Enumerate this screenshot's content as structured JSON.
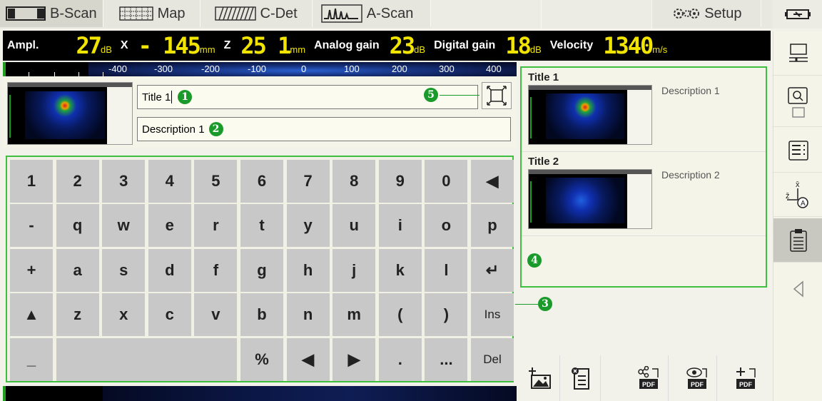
{
  "tabs": [
    {
      "label": "B-Scan",
      "icon": "bscan-icon",
      "active": true
    },
    {
      "label": "Map",
      "icon": "map-icon",
      "active": false
    },
    {
      "label": "C-Det",
      "icon": "cdet-icon",
      "active": false
    },
    {
      "label": "A-Scan",
      "icon": "ascan-icon",
      "active": false
    }
  ],
  "setup_label": "Setup",
  "readout": {
    "ampl_label": "Ampl.",
    "ampl_value": "27",
    "ampl_unit": "dB",
    "x_label": "X",
    "x_value": "- 145",
    "x_unit": "mm",
    "z_label": "Z",
    "z_value": "25 1",
    "z_unit": "mm",
    "analog_label": "Analog gain",
    "analog_value": "23",
    "analog_unit": "dB",
    "digital_label": "Digital gain",
    "digital_value": "18",
    "digital_unit": "dB",
    "velocity_label": "Velocity",
    "velocity_value": "1340",
    "velocity_unit": "m/s"
  },
  "ruler_ticks": [
    "-400",
    "-300",
    "-200",
    "-100",
    "0",
    "100",
    "200",
    "300",
    "400"
  ],
  "editor": {
    "title_value": "Title 1",
    "description_value": "Description 1"
  },
  "callouts": {
    "c1": "1",
    "c2": "2",
    "c3": "3",
    "c4": "4",
    "c5": "5"
  },
  "keyboard": {
    "row1": [
      "1",
      "2",
      "3",
      "4",
      "5",
      "6",
      "7",
      "8",
      "9",
      "0",
      "◀"
    ],
    "row2": [
      "-",
      "q",
      "w",
      "e",
      "r",
      "t",
      "y",
      "u",
      "i",
      "o",
      "p"
    ],
    "row3": [
      "+",
      "a",
      "s",
      "d",
      "f",
      "g",
      "h",
      "j",
      "k",
      "l",
      "↵"
    ],
    "row4": [
      "▲",
      "z",
      "x",
      "c",
      "v",
      "b",
      "n",
      "m",
      "(",
      ")",
      "Ins"
    ],
    "row5": [
      "_",
      "%",
      "◀",
      "▶",
      ".",
      "...",
      "Del"
    ]
  },
  "notes": [
    {
      "title": "Title 1",
      "description": "Description 1"
    },
    {
      "title": "Title 2",
      "description": "Description 2"
    }
  ],
  "sidebar_axis": {
    "x": "x̄",
    "z": "z̄",
    "a": "A"
  },
  "colors": {
    "accent_green": "#3fbf3f",
    "readout_yellow": "#f0e400"
  }
}
